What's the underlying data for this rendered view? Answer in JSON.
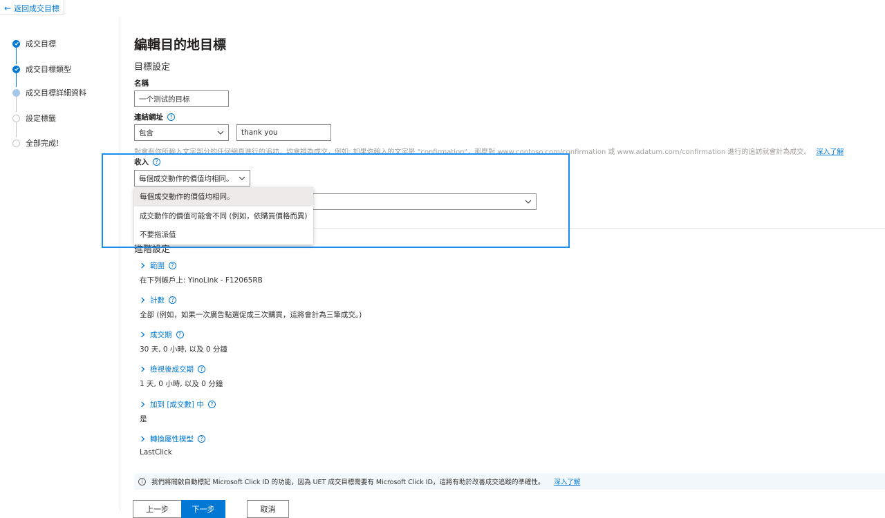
{
  "topbar": {
    "back_label": "返回成交目標"
  },
  "stepper": {
    "steps": [
      {
        "label": "成交目標",
        "state": "done"
      },
      {
        "label": "成交目標類型",
        "state": "done"
      },
      {
        "label": "成交目標詳細資料",
        "state": "current"
      },
      {
        "label": "設定標籤",
        "state": "todo"
      },
      {
        "label": "全部完成!",
        "state": "todo"
      }
    ]
  },
  "page": {
    "title": "編輯目的地目標",
    "section_title": "目標設定",
    "name_label": "名稱",
    "name_value": "一个测试的目标",
    "url_label": "連結網址",
    "url_operator": "包含",
    "url_value": "thank you",
    "url_helptext": "對會有你所輸入文字部分的任何網頁進行的追訪，均會視為成交，例如: 如果你輸入的文字是 \"confirmation\"，那麼對 www.contoso.com/confirmation 或 www.adatum.com/confirmation 進行的追訪就會計為成交。",
    "url_learn_more": "深入了解",
    "revenue_label": "收入",
    "revenue_selected": "每個成交動作的價值均相同。",
    "revenue_options": [
      "每個成交動作的價值均相同。",
      "成交動作的價值可能會不同 (例如，依購買價格而異)",
      "不要指派值"
    ]
  },
  "advanced": {
    "title": "進階設定",
    "items": [
      {
        "label": "範圍",
        "value": "在下列帳戶上: YinoLink - F12065RB"
      },
      {
        "label": "計數",
        "value": "全部 (例如，如果一次廣告點選促成三次購買，這將會計為三筆成交。)"
      },
      {
        "label": "成交期",
        "value": "30 天, 0 小時, 以及 0 分鐘"
      },
      {
        "label": "檢視後成交期",
        "value": "1 天, 0 小時, 以及 0 分鐘"
      },
      {
        "label": "加到 [成交數] 中",
        "value": "是"
      },
      {
        "label": "轉換屬性模型",
        "value": "LastClick"
      }
    ]
  },
  "info_bar": {
    "text": "我們將開啟自動標記 Microsoft Click ID 的功能，因為 UET 成交目標需要有 Microsoft Click ID，這將有助於改善成交追蹤的準確性。",
    "learn_more": "深入了解"
  },
  "buttons": {
    "prev": "上一步",
    "next": "下一步",
    "cancel": "取消"
  },
  "colors": {
    "accent": "#0078d4",
    "highlight_box": "#1a8cf0"
  }
}
